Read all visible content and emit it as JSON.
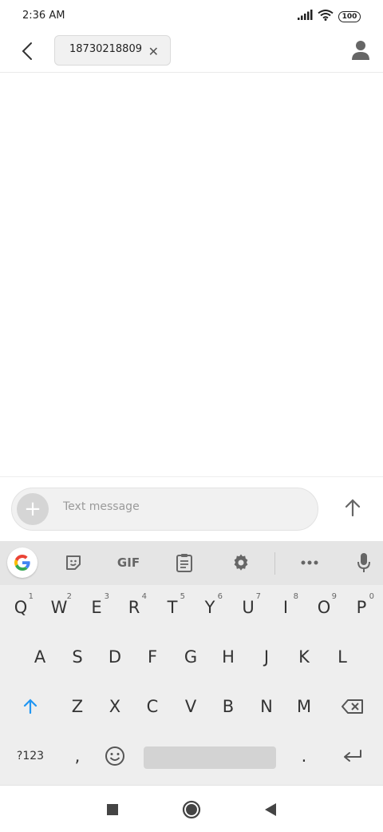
{
  "status": {
    "time": "2:36 AM",
    "battery": "100"
  },
  "header": {
    "recipient": "18730218809"
  },
  "composer": {
    "placeholder": "Text message"
  },
  "keyboard": {
    "toolbar": {
      "gif": "GIF"
    },
    "row1": [
      {
        "label": "Q",
        "hint": "1"
      },
      {
        "label": "W",
        "hint": "2"
      },
      {
        "label": "E",
        "hint": "3"
      },
      {
        "label": "R",
        "hint": "4"
      },
      {
        "label": "T",
        "hint": "5"
      },
      {
        "label": "Y",
        "hint": "6"
      },
      {
        "label": "U",
        "hint": "7"
      },
      {
        "label": "I",
        "hint": "8"
      },
      {
        "label": "O",
        "hint": "9"
      },
      {
        "label": "P",
        "hint": "0"
      }
    ],
    "row2": [
      "A",
      "S",
      "D",
      "F",
      "G",
      "H",
      "J",
      "K",
      "L"
    ],
    "row3": [
      "Z",
      "X",
      "C",
      "V",
      "B",
      "N",
      "M"
    ],
    "row4": {
      "symbols": "?123",
      "comma": ",",
      "period": "."
    }
  }
}
